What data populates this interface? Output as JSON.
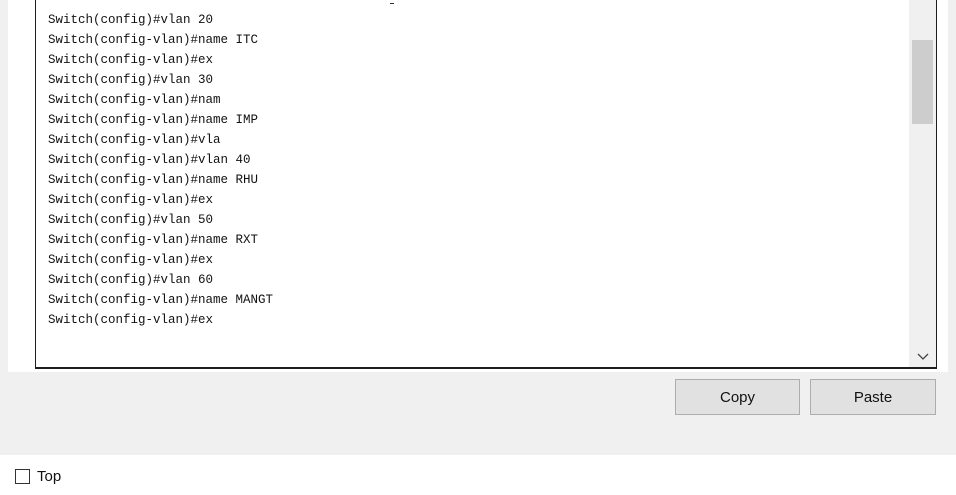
{
  "console": {
    "lines": [
      "Switch(config)#vlan 20",
      "Switch(config-vlan)#name ITC",
      "Switch(config-vlan)#ex",
      "Switch(config)#vlan 30",
      "Switch(config-vlan)#nam",
      "Switch(config-vlan)#name IMP",
      "Switch(config-vlan)#vla",
      "Switch(config-vlan)#vlan 40",
      "Switch(config-vlan)#name RHU",
      "Switch(config-vlan)#ex",
      "Switch(config)#vlan 50",
      "Switch(config-vlan)#name RXT",
      "Switch(config-vlan)#ex",
      "Switch(config)#vlan 60",
      "Switch(config-vlan)#name MANGT",
      "Switch(config-vlan)#ex"
    ]
  },
  "buttons": {
    "copy_label": "Copy",
    "paste_label": "Paste"
  },
  "options": {
    "top_label": "Top",
    "top_checked": false
  },
  "icons": {
    "scroll_down": "chevron-down-icon",
    "checkbox": "checkbox-icon"
  },
  "colors": {
    "panel_background": "#f0f0f0",
    "console_background": "#ffffff",
    "console_border": "#1e1e1e",
    "scroll_thumb": "#cdcdcd",
    "button_face": "#e1e1e1",
    "button_border": "#adadad"
  }
}
